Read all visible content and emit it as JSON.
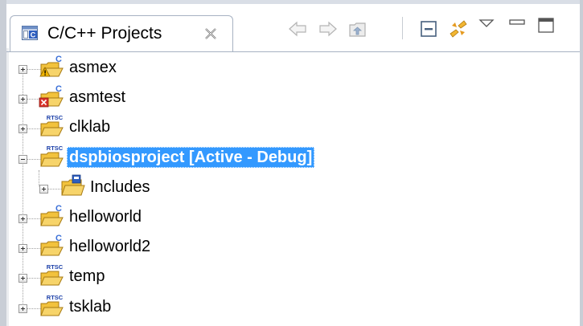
{
  "view": {
    "tab": {
      "title": "C/C++ Projects",
      "icon": "cpp-projects-view-icon",
      "close_icon": "close-tab-icon"
    },
    "toolbar": [
      {
        "name": "back-button",
        "icon": "arrow-left-icon"
      },
      {
        "name": "forward-button",
        "icon": "arrow-right-icon"
      },
      {
        "name": "up-button",
        "icon": "go-up-folder-icon"
      },
      {
        "name": "collapse-all-button",
        "icon": "collapse-all-icon"
      },
      {
        "name": "link-with-editor-button",
        "icon": "link-with-editor-icon"
      },
      {
        "name": "view-menu-button",
        "icon": "triangle-down-icon"
      },
      {
        "name": "minimize-button",
        "icon": "minimize-icon"
      },
      {
        "name": "maximize-button",
        "icon": "maximize-icon"
      }
    ]
  },
  "tree": {
    "items": [
      {
        "label": "asmex",
        "badge": "C",
        "overlay": "warning",
        "expanded": false,
        "selected": false,
        "depth": 0
      },
      {
        "label": "asmtest",
        "badge": "C",
        "overlay": "error",
        "expanded": false,
        "selected": false,
        "depth": 0
      },
      {
        "label": "clklab",
        "badge": "RTSC",
        "overlay": "",
        "expanded": false,
        "selected": false,
        "depth": 0
      },
      {
        "label": "dspbiosproject  [Active - Debug]",
        "badge": "RTSC",
        "overlay": "",
        "expanded": true,
        "selected": true,
        "depth": 0
      },
      {
        "label": "Includes",
        "badge": "",
        "overlay": "",
        "expanded": false,
        "selected": false,
        "depth": 1
      },
      {
        "label": "helloworld",
        "badge": "C",
        "overlay": "",
        "expanded": false,
        "selected": false,
        "depth": 0
      },
      {
        "label": "helloworld2",
        "badge": "C",
        "overlay": "",
        "expanded": false,
        "selected": false,
        "depth": 0
      },
      {
        "label": "temp",
        "badge": "RTSC",
        "overlay": "",
        "expanded": false,
        "selected": false,
        "depth": 0
      },
      {
        "label": "tsklab",
        "badge": "RTSC",
        "overlay": "",
        "expanded": false,
        "selected": false,
        "depth": 0
      }
    ]
  },
  "colors": {
    "selection": "#3399ff",
    "folder": "#f2c23c",
    "c_badge": "#3a6fd8",
    "rtsc_badge": "#1b3fa8",
    "error": "#d9342b",
    "warning": "#f0b400"
  }
}
